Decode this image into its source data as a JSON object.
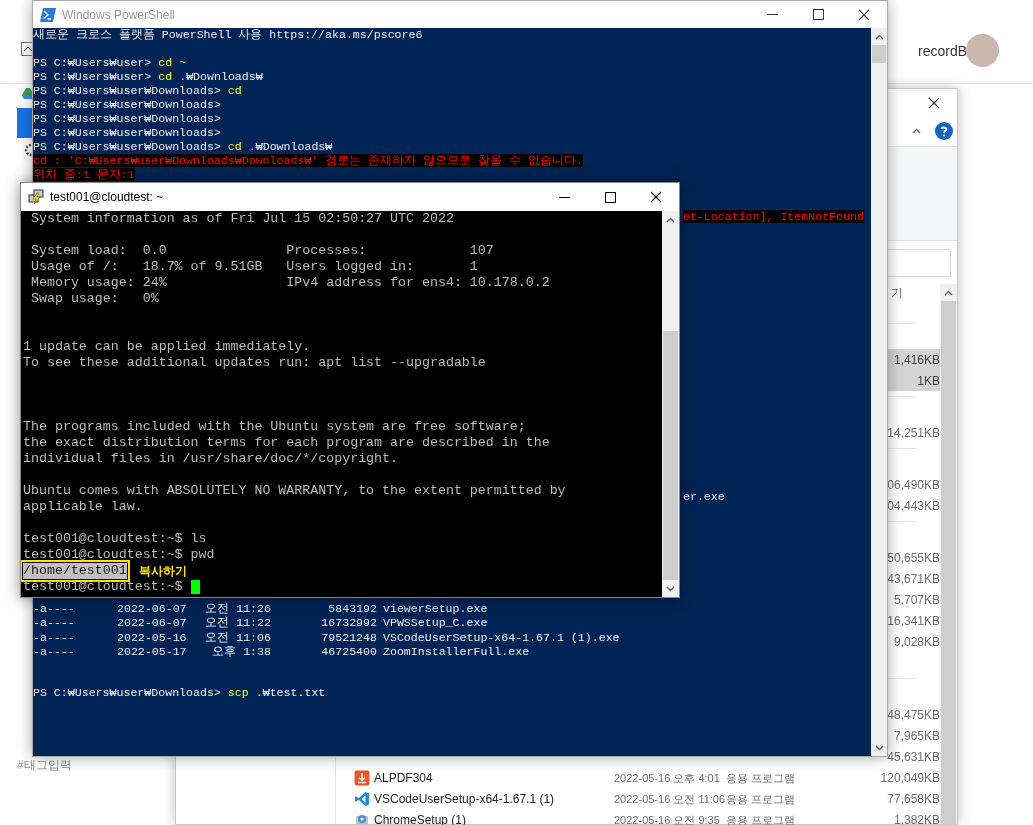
{
  "browser": {
    "user_name": "recordB",
    "tag_hint": "#태그입력"
  },
  "explorer": {
    "column_header": "기",
    "groups": [
      {
        "rows": [
          {
            "kind": "file",
            "size": "1,416KB",
            "selected": true
          },
          {
            "kind": "file",
            "size": "1KB",
            "selected": true
          }
        ]
      },
      {
        "rows": [
          {
            "kind": "file",
            "size": "14,251KB",
            "selected": false
          }
        ]
      },
      {
        "rows": [
          {
            "kind": "file",
            "size": "06,490KB",
            "selected": false
          },
          {
            "kind": "file",
            "size": "04,443KB",
            "selected": false
          }
        ]
      },
      {
        "rows": [
          {
            "kind": "file",
            "size": "50,655KB",
            "selected": false
          },
          {
            "kind": "file",
            "size": "43,671KB",
            "selected": false
          },
          {
            "kind": "file",
            "size": "5,707KB",
            "selected": false
          },
          {
            "kind": "file",
            "size": "16,341KB",
            "selected": false
          },
          {
            "kind": "file",
            "size": "9,028KB",
            "selected": false
          },
          {
            "kind": "folder"
          }
        ]
      },
      {
        "rows": [
          {
            "kind": "file",
            "size": "48,475KB",
            "selected": false
          },
          {
            "kind": "file",
            "size": "7,965KB",
            "selected": false
          },
          {
            "kind": "file",
            "size": "45,631KB",
            "selected": false
          },
          {
            "kind": "pdf",
            "name": "ALPDF304",
            "date": "2022-05-16 오후 4:01",
            "type": "응용 프로그램",
            "size": "120,049KB",
            "selected": false
          },
          {
            "kind": "code",
            "name": "VSCodeUserSetup-x64-1.67.1 (1)",
            "date": "2022-05-16 오전 11:06",
            "type": "응용 프로그램",
            "size": "77,658KB",
            "selected": false
          },
          {
            "kind": "setup",
            "name": "ChromeSetup (1)",
            "date": "2022-05-16 오전 9:35",
            "type": "응용 프로그램",
            "size": "1,382KB",
            "selected": false
          }
        ]
      }
    ]
  },
  "powershell": {
    "title": "Windows PowerShell",
    "top_lines": [
      {
        "kind": "text",
        "text": "새로운 크로스 플랫폼 PowerShell 사용 https://aka.ms/pscore6"
      },
      {
        "kind": "blank"
      },
      {
        "kind": "prompt",
        "prompt": "PS C:₩Users₩user>",
        "command": "cd",
        "args": "~",
        "args_highlight": true
      },
      {
        "kind": "prompt",
        "prompt": "PS C:₩Users₩user>",
        "command": "cd",
        "args": ".₩Downloads₩",
        "args_highlight": false
      },
      {
        "kind": "prompt",
        "prompt": "PS C:₩Users₩user₩Downloads>",
        "command": "cd"
      },
      {
        "kind": "prompt",
        "prompt": "PS C:₩Users₩user₩Downloads>"
      },
      {
        "kind": "prompt",
        "prompt": "PS C:₩Users₩user₩Downloads>"
      },
      {
        "kind": "prompt",
        "prompt": "PS C:₩Users₩user₩Downloads>"
      },
      {
        "kind": "prompt",
        "prompt": "PS C:₩Users₩user₩Downloads>",
        "command": "cd",
        "args": ".₩Downloads₩",
        "args_highlight": false
      },
      {
        "kind": "error",
        "text": "cd : 'C:₩Users₩user₩Downloads₩Downloads₩' 경로는 존재하지 않으므로 찾을 수 없습니다."
      },
      {
        "kind": "error",
        "text": "위치 줄:1 문자:1"
      }
    ],
    "fragments": [
      {
        "kind": "error",
        "text": "et-Location], ItemNotFound"
      },
      {
        "kind": "text",
        "text": "er.exe"
      }
    ],
    "listing": [
      {
        "mode": "-a----",
        "date": "2022-06-07",
        "time": "오전 11:26",
        "length": "5843192",
        "name": "viewerSetup.exe"
      },
      {
        "mode": "-a----",
        "date": "2022-06-07",
        "time": "오전 11:22",
        "length": "16732992",
        "name": "VPWSSetup_C.exe"
      },
      {
        "mode": "-a----",
        "date": "2022-05-16",
        "time": "오전 11:06",
        "length": "79521248",
        "name": "VSCodeUserSetup-x64-1.67.1 (1).exe"
      },
      {
        "mode": "-a----",
        "date": "2022-05-17",
        "time": "오후 1:38",
        "length": "46725400",
        "name": "ZoomInstallerFull.exe"
      }
    ],
    "last_prompt": {
      "prompt": "PS C:₩Users₩user₩Downloads>",
      "command": "scp",
      "args": ".₩test.txt"
    }
  },
  "putty": {
    "title": "test001@cloudtest: ~",
    "lines": [
      {
        "kind": "text",
        "text": " System information as of Fri Jul 15 02:50:27 UTC 2022"
      },
      {
        "kind": "blank"
      },
      {
        "kind": "text",
        "text": " System load:  0.0               Processes:             107"
      },
      {
        "kind": "text",
        "text": " Usage of /:   18.7% of 9.51GB   Users logged in:       1"
      },
      {
        "kind": "text",
        "text": " Memory usage: 24%               IPv4 address for ens4: 10.178.0.2"
      },
      {
        "kind": "text",
        "text": " Swap usage:   0%"
      },
      {
        "kind": "blank"
      },
      {
        "kind": "blank"
      },
      {
        "kind": "text",
        "text": "1 update can be applied immediately."
      },
      {
        "kind": "text",
        "text": "To see these additional updates run: apt list --upgradable"
      },
      {
        "kind": "blank"
      },
      {
        "kind": "blank"
      },
      {
        "kind": "blank"
      },
      {
        "kind": "text",
        "text": "The programs included with the Ubuntu system are free software;"
      },
      {
        "kind": "text",
        "text": "the exact distribution terms for each program are described in the"
      },
      {
        "kind": "text",
        "text": "individual files in /usr/share/doc/*/copyright."
      },
      {
        "kind": "blank"
      },
      {
        "kind": "text",
        "text": "Ubuntu comes with ABSOLUTELY NO WARRANTY, to the extent permitted by"
      },
      {
        "kind": "text",
        "text": "applicable law."
      },
      {
        "kind": "blank"
      },
      {
        "kind": "text",
        "text": "test001@cloudtest:~$ ls"
      },
      {
        "kind": "text",
        "text": "test001@cloudtest:~$ pwd"
      },
      {
        "kind": "selection",
        "text": "/home/test001",
        "annotation": "복사하기"
      },
      {
        "kind": "cursor",
        "text": "test001@cloudtest:~$"
      }
    ]
  }
}
